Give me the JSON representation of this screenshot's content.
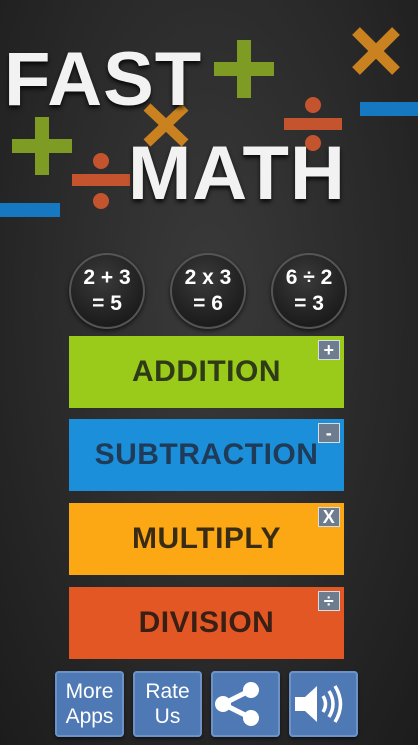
{
  "title": {
    "line1": "FAST",
    "line2": "MATH"
  },
  "examples": [
    {
      "line1": "2 + 3",
      "line2": "= 5"
    },
    {
      "line1": "2 x 3",
      "line2": "= 6"
    },
    {
      "line1": "6 ÷ 2",
      "line2": "= 3"
    }
  ],
  "operations": [
    {
      "label": "ADDITION",
      "symbol": "+",
      "color": "#9acb1b",
      "text_color": "#2f3a17"
    },
    {
      "label": "SUBTRACTION",
      "symbol": "-",
      "color": "#1b8fd9",
      "text_color": "#1f3b57"
    },
    {
      "label": "MULTIPLY",
      "symbol": "X",
      "color": "#fba814",
      "text_color": "#3a2c14"
    },
    {
      "label": "DIVISION",
      "symbol": "÷",
      "color": "#e35725",
      "text_color": "#3a1f14"
    }
  ],
  "bottom_bar": {
    "more_apps": {
      "line1": "More",
      "line2": "Apps"
    },
    "rate_us": {
      "line1": "Rate",
      "line2": "Us"
    },
    "share_icon": "share-icon",
    "sound_icon": "speaker-icon"
  },
  "colors": {
    "plus": "#7e9b23",
    "times": "#c9821f",
    "divide": "#c4542e",
    "minus": "#1778c2",
    "button_blue": "#4f79b5"
  }
}
